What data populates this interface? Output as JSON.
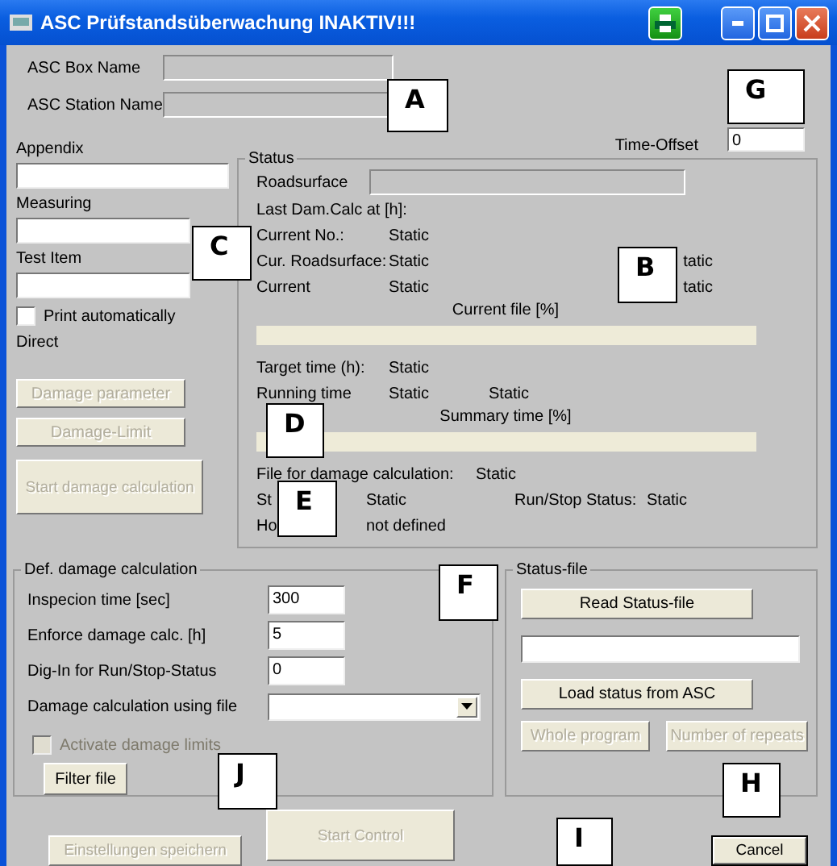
{
  "window": {
    "title": "ASC Prüfstandsüberwachung INAKTIV!!!"
  },
  "header_fields": [
    {
      "label": "ASC Box Name"
    },
    {
      "label": "ASC Station Name"
    }
  ],
  "time_offset": {
    "label": "Time-Offset",
    "value": "0"
  },
  "left_fields": [
    {
      "label": "Appendix"
    },
    {
      "label": "Measuring"
    },
    {
      "label": "Test Item"
    }
  ],
  "print_automatically": {
    "label": "Print automatically",
    "checked": false
  },
  "direct_label": "Direct",
  "left_buttons": [
    {
      "label": "Damage parameter",
      "disabled": true,
      "kind": "small"
    },
    {
      "label": "Damage-Limit",
      "disabled": true,
      "kind": "small"
    },
    {
      "label": "Start damage calculation",
      "disabled": true,
      "kind": "tall"
    }
  ],
  "status": {
    "title": "Status",
    "roadsurface_label": "Roadsurface",
    "rows": [
      {
        "kind": "single",
        "cells": [
          "Last Dam.Calc at [h]:"
        ]
      },
      {
        "kind": "pair",
        "cells": [
          "Current No.:",
          "Static"
        ]
      },
      {
        "kind": "pair_right",
        "cells": [
          "Cur. Roadsurface:",
          "Static",
          "tatic"
        ]
      },
      {
        "kind": "pair_right",
        "cells": [
          "Current",
          "Static",
          "tatic"
        ]
      },
      {
        "kind": "progress",
        "cells": [
          "Current file [%]"
        ],
        "level": 0
      },
      {
        "kind": "pair",
        "cells": [
          "Target time (h):",
          "Static"
        ]
      },
      {
        "kind": "triple",
        "cells": [
          "Running time",
          "Static",
          "Static"
        ]
      },
      {
        "kind": "progress",
        "cells": [
          "Summary time [%]"
        ],
        "level": 0
      },
      {
        "kind": "file",
        "cells": [
          "File for damage calculation:",
          "Static"
        ]
      },
      {
        "kind": "quad",
        "cells": [
          "St",
          "Static",
          "Run/Stop Status:",
          "Static"
        ]
      },
      {
        "kind": "hours",
        "cells": [
          "Ho",
          "not defined"
        ]
      }
    ]
  },
  "damage_calc": {
    "title": "Def. damage calculation",
    "inputs": [
      {
        "label": "Inspecion time  [sec]",
        "value": "300"
      },
      {
        "label": "Enforce damage calc. [h]",
        "value": "5"
      },
      {
        "label": "Dig-In for Run/Stop-Status",
        "value": "0"
      }
    ],
    "dropdown": {
      "label": "Damage calculation using file"
    },
    "limits_checkbox": {
      "label": "Activate damage limits",
      "checked": false,
      "disabled": true
    },
    "filter_button": {
      "label": "Filter file"
    }
  },
  "status_file": {
    "title": "Status-file",
    "read_button": {
      "label": "Read Status-file"
    },
    "load_button": {
      "label": "Load status from ASC"
    },
    "buttons": [
      {
        "label": "Whole program",
        "disabled": true
      },
      {
        "label": "Number of repeats",
        "disabled": true
      }
    ]
  },
  "bottom_buttons": [
    {
      "label": "Einstellungen speichern",
      "disabled": true,
      "kind": "save"
    },
    {
      "label": "Start Control",
      "disabled": true,
      "kind": "start"
    },
    {
      "label": "Cancel",
      "disabled": false,
      "kind": "cancel"
    }
  ],
  "callouts": [
    {
      "letter": "A"
    },
    {
      "letter": "G"
    },
    {
      "letter": "B"
    },
    {
      "letter": "C"
    },
    {
      "letter": "D"
    },
    {
      "letter": "E"
    },
    {
      "letter": "F"
    },
    {
      "letter": "J"
    },
    {
      "letter": "H"
    },
    {
      "letter": "I"
    }
  ]
}
